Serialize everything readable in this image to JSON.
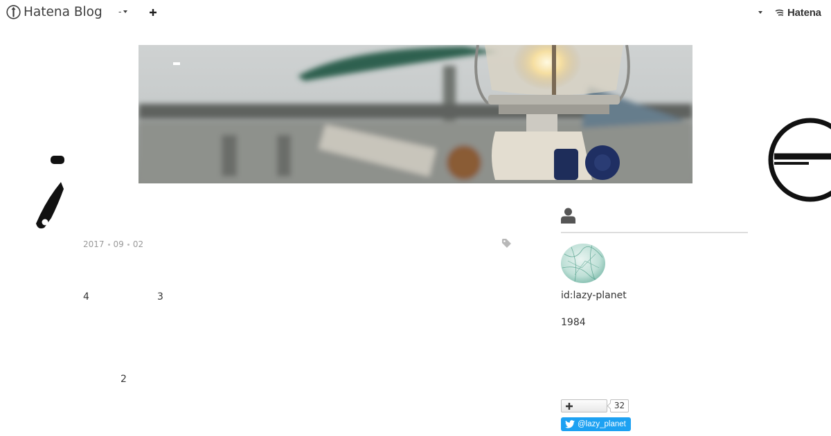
{
  "global_header": {
    "brand_text": "Hatena Blog",
    "menu_label": "-",
    "hatena_text": "Hatena"
  },
  "entry": {
    "date": {
      "year": "2017",
      "month": "09",
      "day": "02"
    },
    "body": [
      "4",
      "3",
      "2"
    ]
  },
  "sidebar": {
    "profile_id": "id:lazy-planet",
    "profile_year": "1984",
    "follow_count": "32",
    "twitter_label": "@lazy_planet"
  },
  "colors": {
    "twitter_blue": "#1da1f2",
    "text": "#333333",
    "muted": "#999999"
  }
}
